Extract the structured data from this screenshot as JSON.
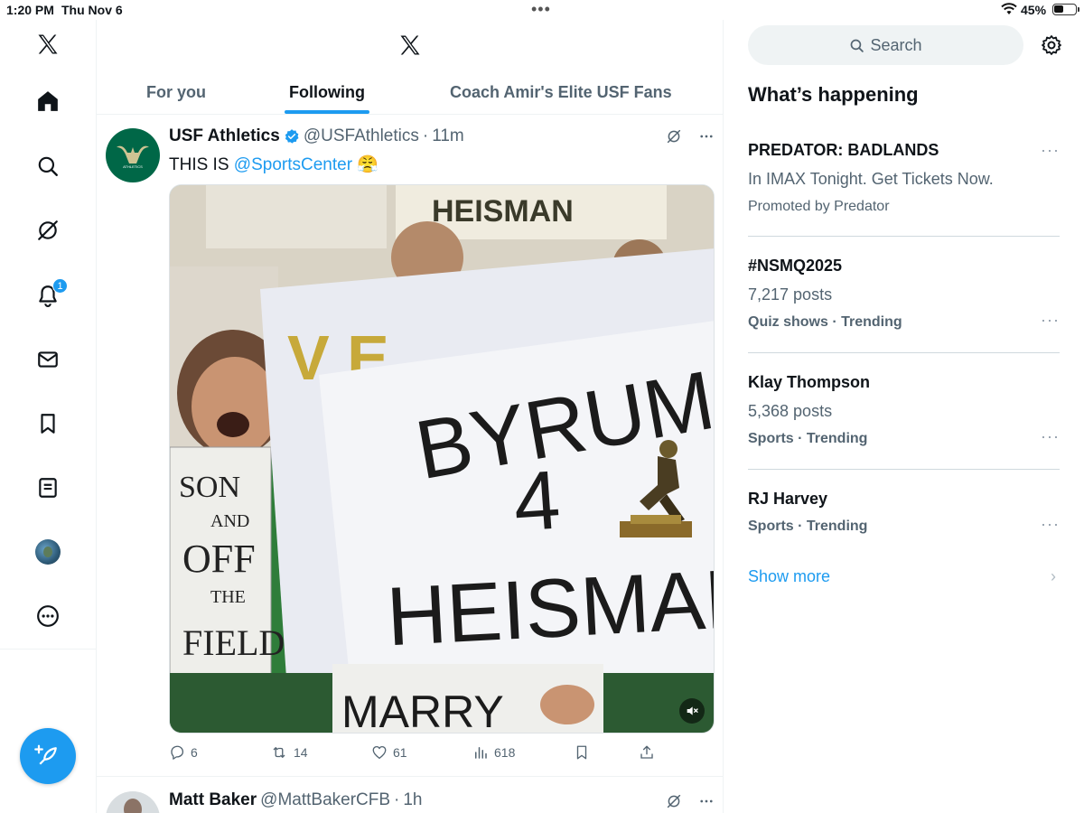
{
  "status_bar": {
    "time": "1:20 PM",
    "date": "Thu Nov 6",
    "battery_percent": "45%",
    "battery_level": 0.45,
    "dots": "•••"
  },
  "nav": {
    "notifications_badge": "1",
    "items": [
      "home-icon",
      "search-icon",
      "grok-icon",
      "notifications-icon",
      "messages-icon",
      "bookmarks-icon",
      "lists-icon",
      "profile-avatar",
      "more-icon"
    ]
  },
  "tabs": [
    {
      "label": "For you",
      "active": false
    },
    {
      "label": "Following",
      "active": true
    },
    {
      "label": "Coach Amir's Elite USF Fans",
      "active": false
    }
  ],
  "tweets": [
    {
      "name": "USF Athletics",
      "handle": "@USFAthletics",
      "sep": "·",
      "time": "11m",
      "text_prefix": "THIS IS ",
      "mention": "@SportsCenter",
      "emoji": "😤",
      "media": {
        "sign_line1": "BYRUM",
        "sign_line2": "4",
        "sign_line3": "HEISMAN",
        "left_sign": "SON AND OFF THE FIELD",
        "top_sign": "HEISMAN"
      },
      "replies": "6",
      "reposts": "14",
      "likes": "61",
      "views": "618"
    },
    {
      "name": "Matt Baker",
      "handle": "@MattBakerCFB",
      "sep": "·",
      "time": "1h"
    }
  ],
  "right": {
    "search_placeholder": "Search",
    "section_title": "What’s happening",
    "trends": [
      {
        "title": "PREDATOR: BADLANDS",
        "sub": "In IMAX Tonight. Get Tickets Now.",
        "meta": "Promoted by Predator",
        "meta_bold": false
      },
      {
        "title": "#NSMQ2025",
        "sub": "7,217 posts",
        "meta": "Quiz shows · Trending",
        "meta_bold": true
      },
      {
        "title": "Klay Thompson",
        "sub": "5,368 posts",
        "meta": "Sports · Trending",
        "meta_bold": true
      },
      {
        "title": "RJ Harvey",
        "sub": "",
        "meta": "Sports · Trending",
        "meta_bold": true
      }
    ],
    "show_more": "Show more",
    "more_glyph": "···",
    "chevron": "›"
  },
  "colors": {
    "accent": "#1d9bf0",
    "usf_green": "#006747",
    "usf_gold": "#cfc493"
  }
}
